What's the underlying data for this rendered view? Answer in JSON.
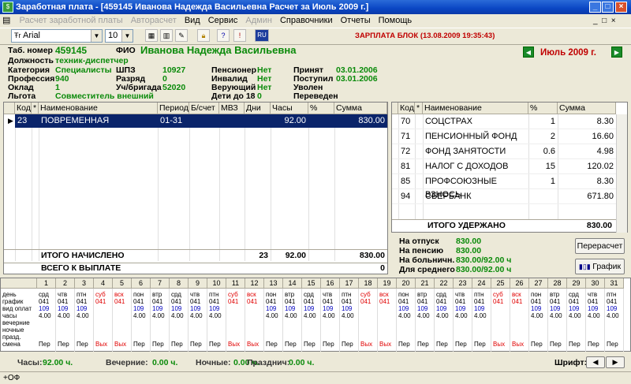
{
  "window": {
    "title": "Заработная плата - [459145 Иванова Надежда Васильевна Расчет за Июль 2009 г.]"
  },
  "menu": [
    {
      "label": "Расчет заработной платы",
      "disabled": true
    },
    {
      "label": "Авторасчет",
      "disabled": true
    },
    {
      "label": "Вид",
      "disabled": false
    },
    {
      "label": "Сервис",
      "disabled": false
    },
    {
      "label": "Админ",
      "disabled": true
    },
    {
      "label": "Справочники",
      "disabled": false
    },
    {
      "label": "Отчеты",
      "disabled": false
    },
    {
      "label": "Помощь",
      "disabled": false
    }
  ],
  "toolbar": {
    "font_name": "Arial",
    "font_size": "10",
    "lang_badge": "RU",
    "block_status": "ЗАРПЛАТА БЛОК (13.08.2009 19:35:43)"
  },
  "period": {
    "month": "Июль 2009 г."
  },
  "employee": {
    "tab_label": "Таб. номер",
    "tab_value": "459145",
    "fio_label": "ФИО",
    "fio_value": "Иванова Надежда Васильевна",
    "position_label": "Должность",
    "position_value": "техник-диспетчер",
    "category_label": "Категория",
    "category_value": "Специалисты",
    "profession_label": "Профессия",
    "profession_value": "940",
    "salary_label": "Оклад",
    "salary_value": "1",
    "benefit_label": "Льгота",
    "benefit_value": "Совместитель внешний",
    "shpz_label": "ШПЗ",
    "shpz_value": "10927",
    "grade_label": "Разряд",
    "grade_value": "0",
    "brigade_label": "Уч/бригада",
    "brigade_value": "52020",
    "pensioner_label": "Пенсионер",
    "pensioner_value": "Нет",
    "invalid_label": "Инвалид",
    "invalid_value": "Нет",
    "believer_label": "Верующий",
    "believer_value": "Нет",
    "children_label": "Дети до 18",
    "children_value": "0",
    "hired_label": "Принят",
    "hired_value": "03.01.2006",
    "entered_label": "Поступил",
    "entered_value": "03.01.2006",
    "fired_label": "Уволен",
    "fired_value": "",
    "transferred_label": "Переведен",
    "transferred_value": ""
  },
  "accruals": {
    "headers": [
      "Код",
      "*",
      "Наименование",
      "Период",
      "Б/счет",
      "МВЗ",
      "Дни",
      "Часы",
      "%",
      "Сумма"
    ],
    "rows": [
      {
        "code": "23",
        "star": "",
        "name": "ПОВРЕМЕННАЯ СОВМЕСТ.",
        "period": "01-31",
        "bs": "",
        "mvz": "",
        "days": "",
        "hours": "92.00",
        "pct": "",
        "sum": "830.00"
      }
    ],
    "total_label": "ИТОГО НАЧИСЛЕНО",
    "total_days": "23",
    "total_hours": "92.00",
    "total_sum": "830.00",
    "payout_label": "ВСЕГО К ВЫПЛАТЕ",
    "payout_sum": "0"
  },
  "deductions": {
    "headers": [
      "Код",
      "*",
      "Наименование",
      "%",
      "Сумма"
    ],
    "rows": [
      {
        "code": "70",
        "name": "СОЦСТРАХ",
        "pct": "1",
        "sum": "8.30"
      },
      {
        "code": "71",
        "name": "ПЕНСИОННЫЙ ФОНД",
        "pct": "2",
        "sum": "16.60"
      },
      {
        "code": "72",
        "name": "ФОНД ЗАНЯТОСТИ",
        "pct": "0.6",
        "sum": "4.98"
      },
      {
        "code": "81",
        "name": "НАЛОГ С ДОХОДОВ",
        "pct": "15",
        "sum": "120.02"
      },
      {
        "code": "85",
        "name": "ПРОФСОЮЗНЫЕ ВЗНОСЬ",
        "pct": "1",
        "sum": "8.30"
      },
      {
        "code": "94",
        "name": "СБЕРБАНК",
        "pct": "",
        "sum": "671.80"
      }
    ],
    "total_label": "ИТОГО УДЕРЖАНО",
    "total_sum": "830.00"
  },
  "averages": {
    "vacation_label": "На отпуск",
    "vacation_value": "830.00",
    "pension_label": "На пенсию",
    "pension_value": "830.00",
    "sick_label": "На больничн.",
    "sick_value": "830.00/92.00 ч",
    "avg_label": "Для среднего",
    "avg_value": "830.00/92.00 ч",
    "recalc_button": "Перерасчет",
    "graph_button": "График"
  },
  "calendar": {
    "row_labels": [
      "день",
      "график",
      "вид оплат",
      "часы",
      "вечерние",
      "ночные",
      "празд.",
      "смена"
    ],
    "days": [
      {
        "n": "1",
        "wd": "срд",
        "g": "041",
        "vo": "109",
        "h": "4.00",
        "s": "Пер",
        "off": false
      },
      {
        "n": "2",
        "wd": "чтв",
        "g": "041",
        "vo": "109",
        "h": "4.00",
        "s": "Пер",
        "off": false
      },
      {
        "n": "3",
        "wd": "птн",
        "g": "041",
        "vo": "109",
        "h": "4.00",
        "s": "Пер",
        "off": false
      },
      {
        "n": "4",
        "wd": "суб",
        "g": "041",
        "vo": "",
        "h": "",
        "s": "Вых",
        "off": true
      },
      {
        "n": "5",
        "wd": "вск",
        "g": "041",
        "vo": "",
        "h": "",
        "s": "Вых",
        "off": true
      },
      {
        "n": "6",
        "wd": "пон",
        "g": "041",
        "vo": "109",
        "h": "4.00",
        "s": "Пер",
        "off": false
      },
      {
        "n": "7",
        "wd": "втр",
        "g": "041",
        "vo": "109",
        "h": "4.00",
        "s": "Пер",
        "off": false
      },
      {
        "n": "8",
        "wd": "срд",
        "g": "041",
        "vo": "109",
        "h": "4.00",
        "s": "Пер",
        "off": false
      },
      {
        "n": "9",
        "wd": "чтв",
        "g": "041",
        "vo": "109",
        "h": "4.00",
        "s": "Пер",
        "off": false
      },
      {
        "n": "10",
        "wd": "птн",
        "g": "041",
        "vo": "109",
        "h": "4.00",
        "s": "Пер",
        "off": false
      },
      {
        "n": "11",
        "wd": "суб",
        "g": "041",
        "vo": "",
        "h": "",
        "s": "Вых",
        "off": true
      },
      {
        "n": "12",
        "wd": "вск",
        "g": "041",
        "vo": "",
        "h": "",
        "s": "Вых",
        "off": true
      },
      {
        "n": "13",
        "wd": "пон",
        "g": "041",
        "vo": "109",
        "h": "4.00",
        "s": "Пер",
        "off": false
      },
      {
        "n": "14",
        "wd": "втр",
        "g": "041",
        "vo": "109",
        "h": "4.00",
        "s": "Пер",
        "off": false
      },
      {
        "n": "15",
        "wd": "срд",
        "g": "041",
        "vo": "109",
        "h": "4.00",
        "s": "Пер",
        "off": false
      },
      {
        "n": "16",
        "wd": "чтв",
        "g": "041",
        "vo": "109",
        "h": "4.00",
        "s": "Пер",
        "off": false
      },
      {
        "n": "17",
        "wd": "птн",
        "g": "041",
        "vo": "109",
        "h": "4.00",
        "s": "Пер",
        "off": false
      },
      {
        "n": "18",
        "wd": "суб",
        "g": "041",
        "vo": "",
        "h": "",
        "s": "Вых",
        "off": true
      },
      {
        "n": "19",
        "wd": "вск",
        "g": "041",
        "vo": "",
        "h": "",
        "s": "Вых",
        "off": true
      },
      {
        "n": "20",
        "wd": "пон",
        "g": "041",
        "vo": "109",
        "h": "4.00",
        "s": "Пер",
        "off": false
      },
      {
        "n": "21",
        "wd": "втр",
        "g": "041",
        "vo": "109",
        "h": "4.00",
        "s": "Пер",
        "off": false
      },
      {
        "n": "22",
        "wd": "срд",
        "g": "041",
        "vo": "109",
        "h": "4.00",
        "s": "Пер",
        "off": false
      },
      {
        "n": "23",
        "wd": "чтв",
        "g": "041",
        "vo": "109",
        "h": "4.00",
        "s": "Пер",
        "off": false
      },
      {
        "n": "24",
        "wd": "птн",
        "g": "041",
        "vo": "109",
        "h": "4.00",
        "s": "Пер",
        "off": false
      },
      {
        "n": "25",
        "wd": "суб",
        "g": "041",
        "vo": "",
        "h": "",
        "s": "Вых",
        "off": true
      },
      {
        "n": "26",
        "wd": "вск",
        "g": "041",
        "vo": "",
        "h": "",
        "s": "Вых",
        "off": true
      },
      {
        "n": "27",
        "wd": "пон",
        "g": "041",
        "vo": "109",
        "h": "4.00",
        "s": "Пер",
        "off": false
      },
      {
        "n": "28",
        "wd": "втр",
        "g": "041",
        "vo": "109",
        "h": "4.00",
        "s": "Пер",
        "off": false
      },
      {
        "n": "29",
        "wd": "срд",
        "g": "041",
        "vo": "109",
        "h": "4.00",
        "s": "Пер",
        "off": false
      },
      {
        "n": "30",
        "wd": "чтв",
        "g": "041",
        "vo": "109",
        "h": "4.00",
        "s": "Пер",
        "off": false
      },
      {
        "n": "31",
        "wd": "птн",
        "g": "041",
        "vo": "109",
        "h": "4.00",
        "s": "Пер",
        "off": false
      }
    ]
  },
  "footer": {
    "hours_label": "Часы:",
    "hours_value": "92.00 ч.",
    "evening_label": "Вечерние:",
    "evening_value": "0.00 ч.",
    "night_label": "Ночные:",
    "night_value": "0.00 ч.",
    "holiday_label": "Празднич:",
    "holiday_value": "0.00 ч.",
    "font_label": "Шрифт:"
  },
  "statusbar": {
    "text": "+ОФ"
  },
  "colors": {
    "green": "#0a8a0a",
    "red": "#c00000",
    "selection": "#0a246a"
  }
}
